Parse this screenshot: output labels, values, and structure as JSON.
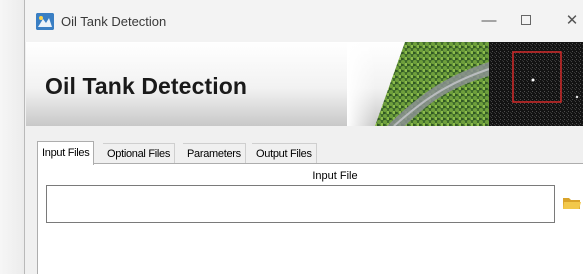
{
  "window": {
    "title": "Oil Tank Detection",
    "controls": {
      "minimize": "—",
      "close": "✕"
    }
  },
  "banner": {
    "title": "Oil Tank Detection"
  },
  "tabs": [
    {
      "label": "Input Files",
      "active": true
    },
    {
      "label": "Optional Files",
      "active": false
    },
    {
      "label": "Parameters",
      "active": false
    },
    {
      "label": "Output Files",
      "active": false
    }
  ],
  "input_files": {
    "label": "Input File",
    "value": "",
    "browse_icon": "folder-icon"
  },
  "colors": {
    "accent": "#2a6fb0",
    "folder": "#e8b93c",
    "selection_box": "#d42a2a"
  }
}
